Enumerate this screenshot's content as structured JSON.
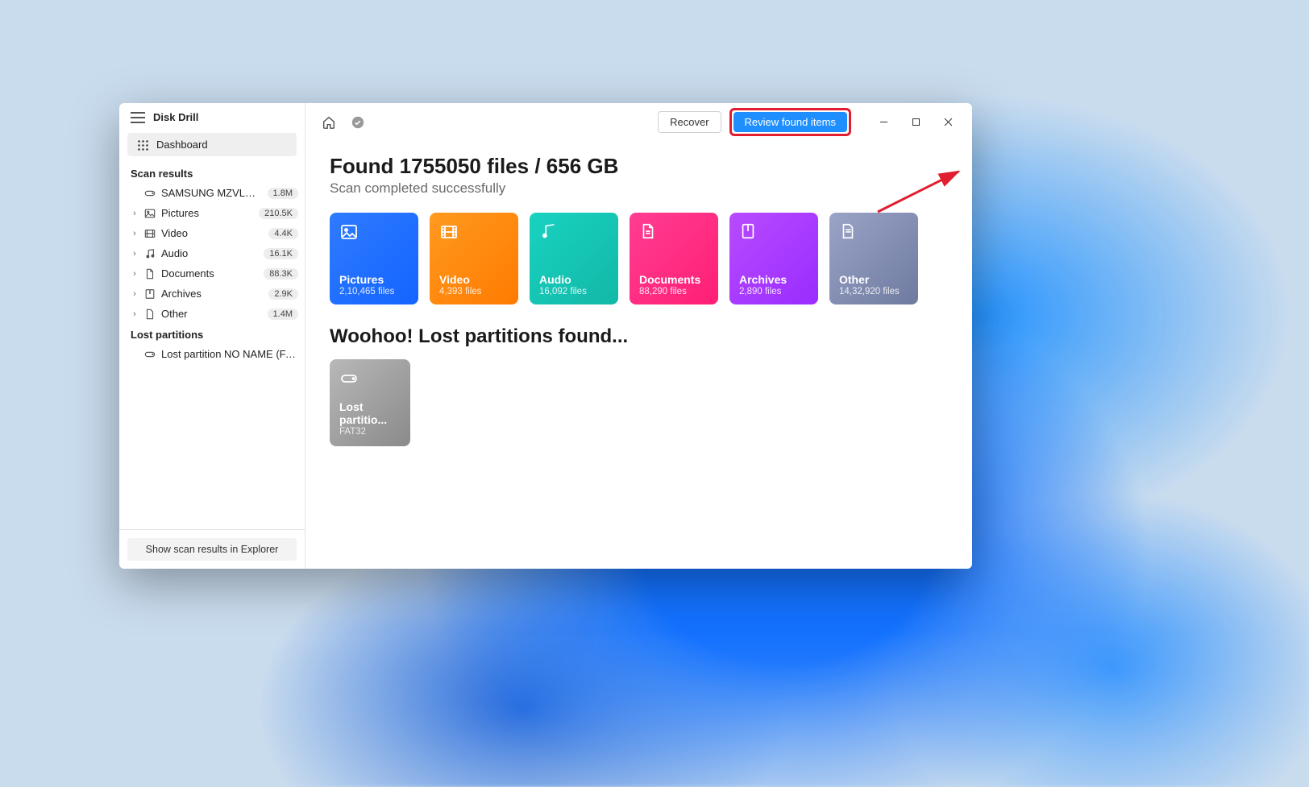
{
  "app": {
    "title": "Disk Drill"
  },
  "sidebar": {
    "dashboard_label": "Dashboard",
    "scan_results_label": "Scan results",
    "device": {
      "label": "SAMSUNG MZVLB1T0...",
      "badge": "1.8M"
    },
    "categories": [
      {
        "label": "Pictures",
        "badge": "210.5K",
        "icon": "image"
      },
      {
        "label": "Video",
        "badge": "4.4K",
        "icon": "film"
      },
      {
        "label": "Audio",
        "badge": "16.1K",
        "icon": "music"
      },
      {
        "label": "Documents",
        "badge": "88.3K",
        "icon": "doc"
      },
      {
        "label": "Archives",
        "badge": "2.9K",
        "icon": "archive"
      },
      {
        "label": "Other",
        "badge": "1.4M",
        "icon": "other"
      }
    ],
    "lost_partitions_label": "Lost partitions",
    "lost_partition_item": "Lost partition NO NAME (FAT...",
    "footer_button": "Show scan results in Explorer"
  },
  "topbar": {
    "recover_label": "Recover",
    "review_label": "Review found items"
  },
  "results": {
    "title": "Found 1755050 files / 656 GB",
    "subtitle": "Scan completed successfully",
    "tiles": [
      {
        "kind": "pictures",
        "title": "Pictures",
        "sub": "2,10,465 files"
      },
      {
        "kind": "video",
        "title": "Video",
        "sub": "4,393 files"
      },
      {
        "kind": "audio",
        "title": "Audio",
        "sub": "16,092 files"
      },
      {
        "kind": "documents",
        "title": "Documents",
        "sub": "88,290 files"
      },
      {
        "kind": "archives",
        "title": "Archives",
        "sub": "2,890 files"
      },
      {
        "kind": "other",
        "title": "Other",
        "sub": "14,32,920 files"
      }
    ],
    "lost_title": "Woohoo! Lost partitions found...",
    "lost_tile": {
      "title": "Lost partitio...",
      "sub": "FAT32"
    }
  }
}
